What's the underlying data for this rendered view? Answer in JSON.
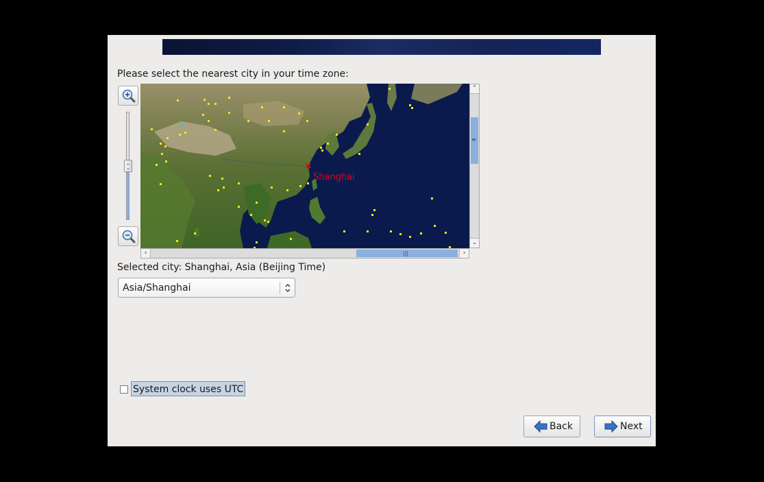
{
  "prompt": "Please select the nearest city in your time zone:",
  "map": {
    "selected_marker_label": "Shanghai",
    "marker_color": "#e0001a",
    "city_dot_color": "#f2ea1a"
  },
  "selected_city": "Selected city: Shanghai, Asia (Beijing Time)",
  "timezone_select": {
    "value": "Asia/Shanghai"
  },
  "utc_checkbox": {
    "label": "System clock uses UTC",
    "checked": false
  },
  "buttons": {
    "back": "Back",
    "next": "Next"
  },
  "colors": {
    "window_bg": "#edeceb",
    "accent": "#8ab0de",
    "button_arrow": "#3a73c2"
  }
}
